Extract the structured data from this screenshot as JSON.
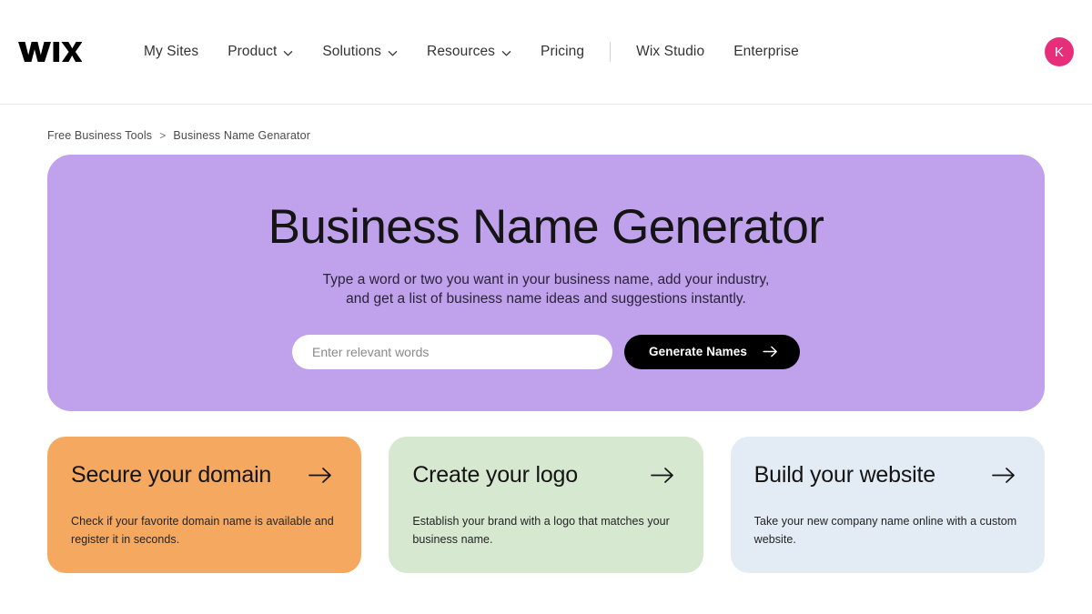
{
  "header": {
    "logo": "WIX",
    "nav_items": [
      {
        "label": "My Sites",
        "has_dropdown": false,
        "icon": null
      },
      {
        "label": "Product",
        "has_dropdown": true,
        "icon": "chevron-down-icon"
      },
      {
        "label": "Solutions",
        "has_dropdown": true,
        "icon": "chevron-down-icon"
      },
      {
        "label": "Resources",
        "has_dropdown": true,
        "icon": "chevron-down-icon"
      },
      {
        "label": "Pricing",
        "has_dropdown": false,
        "icon": null
      },
      {
        "label": "Wix Studio",
        "has_dropdown": false,
        "icon": null
      },
      {
        "label": "Enterprise",
        "has_dropdown": false,
        "icon": null
      }
    ],
    "avatar": {
      "initial": "K",
      "color": "#e62e7b"
    }
  },
  "breadcrumb": {
    "parent": "Free Business Tools",
    "separator": ">",
    "current": "Business Name Genarator"
  },
  "hero": {
    "background_color": "#bfa1ec",
    "title": "Business Name Generator",
    "subtitle_line1": "Type a word or two you want in your business name, add your industry,",
    "subtitle_line2": "and get a list of business name ideas and suggestions instantly.",
    "search": {
      "placeholder": "Enter relevant words",
      "value": ""
    },
    "button": {
      "label": "Generate Names",
      "icon": "arrow-right-icon",
      "background_color": "#000000"
    }
  },
  "cards": [
    {
      "title": "Secure your domain",
      "description": "Check if your favorite domain name is available and register it in seconds.",
      "color": "#f5a960",
      "icon": "arrow-right-icon"
    },
    {
      "title": "Create your logo",
      "description": "Establish your brand with a logo that matches your business name.",
      "color": "#d7e8d0",
      "icon": "arrow-right-icon"
    },
    {
      "title": "Build your website",
      "description": "Take your new company name online with a custom website.",
      "color": "#e3ebf5",
      "icon": "arrow-right-icon"
    }
  ]
}
